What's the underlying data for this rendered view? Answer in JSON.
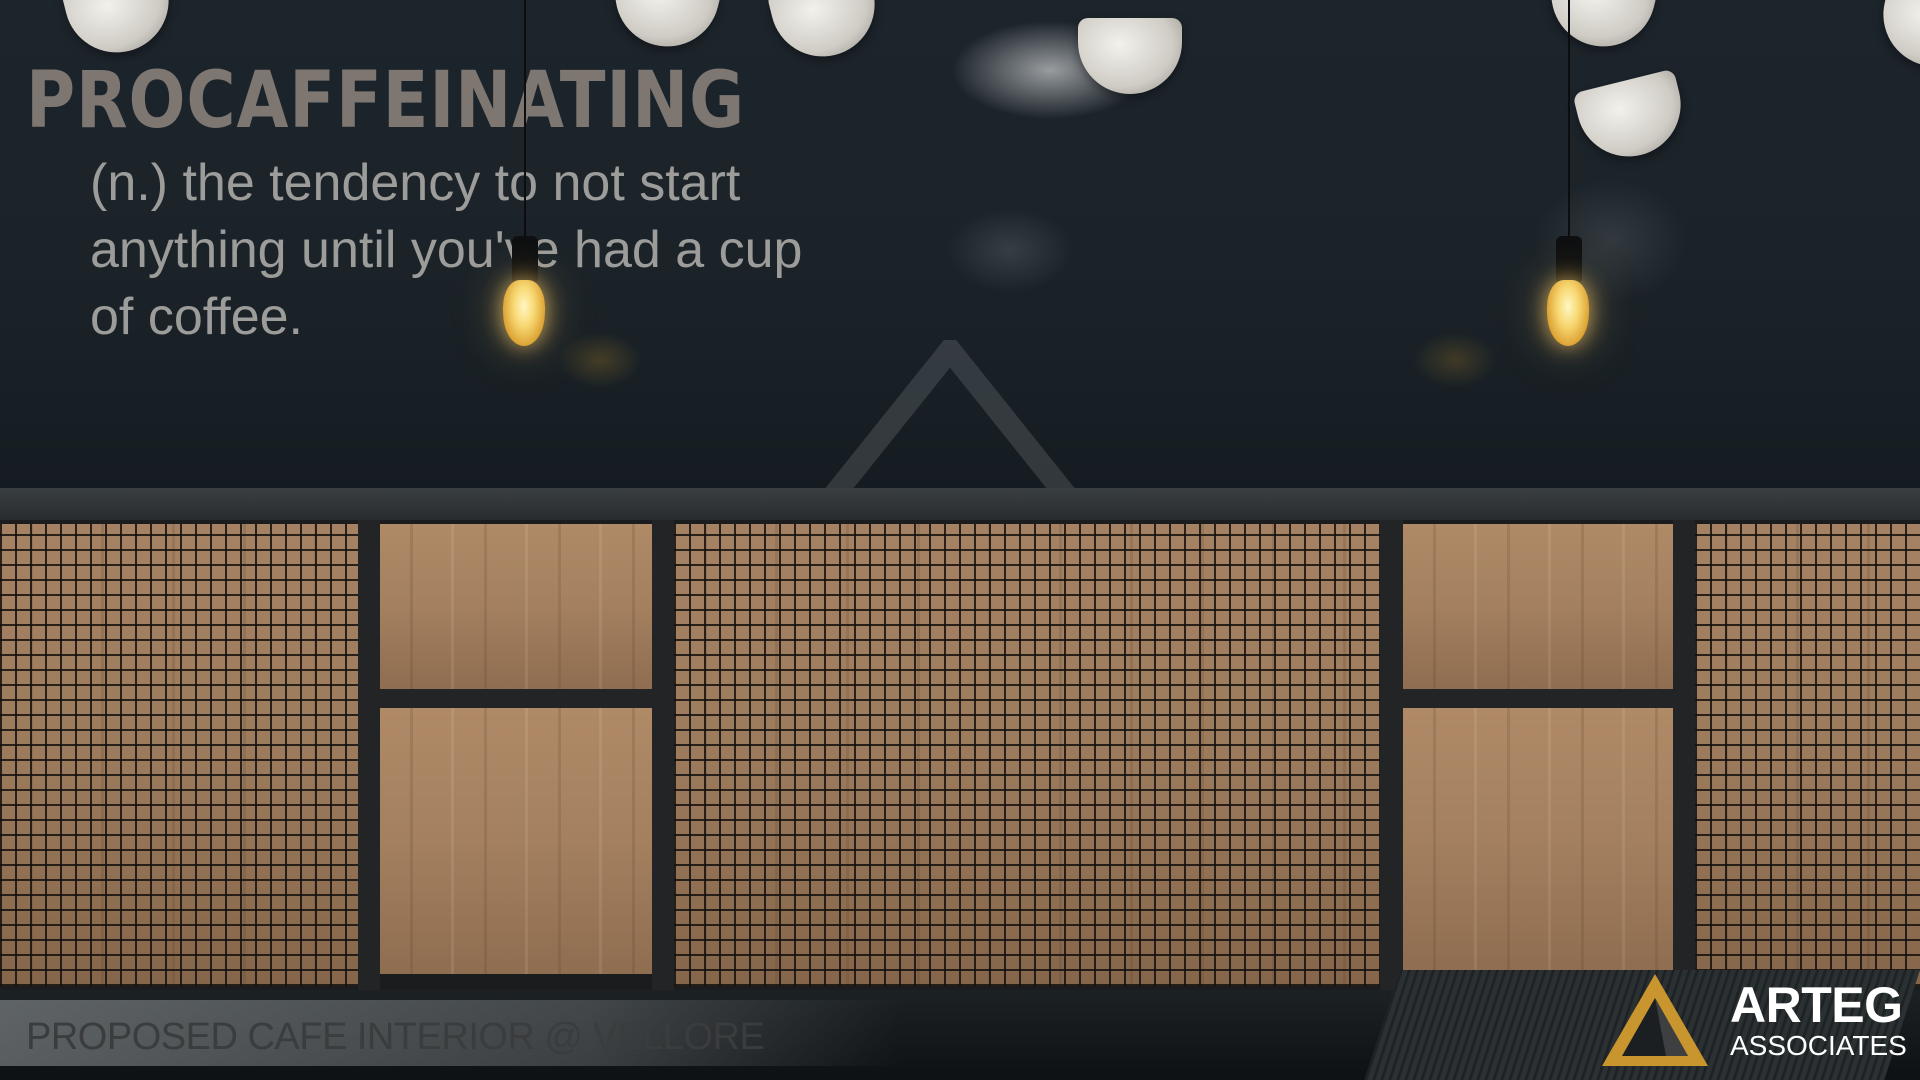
{
  "wall": {
    "word": "PROCAFFEINATING",
    "definition": "(n.) the tendency to not start anything until you've had a cup of coffee."
  },
  "caption": "PROPOSED CAFE INTERIOR @ VELLORE",
  "logo": {
    "name": "ARTEG",
    "subtitle": "ASSOCIATES",
    "icon": "triangle-mark-icon",
    "accent_color": "#c9952e"
  },
  "colors": {
    "wall": "#1b2329",
    "wood": "#a4805f",
    "frame": "#222426"
  }
}
